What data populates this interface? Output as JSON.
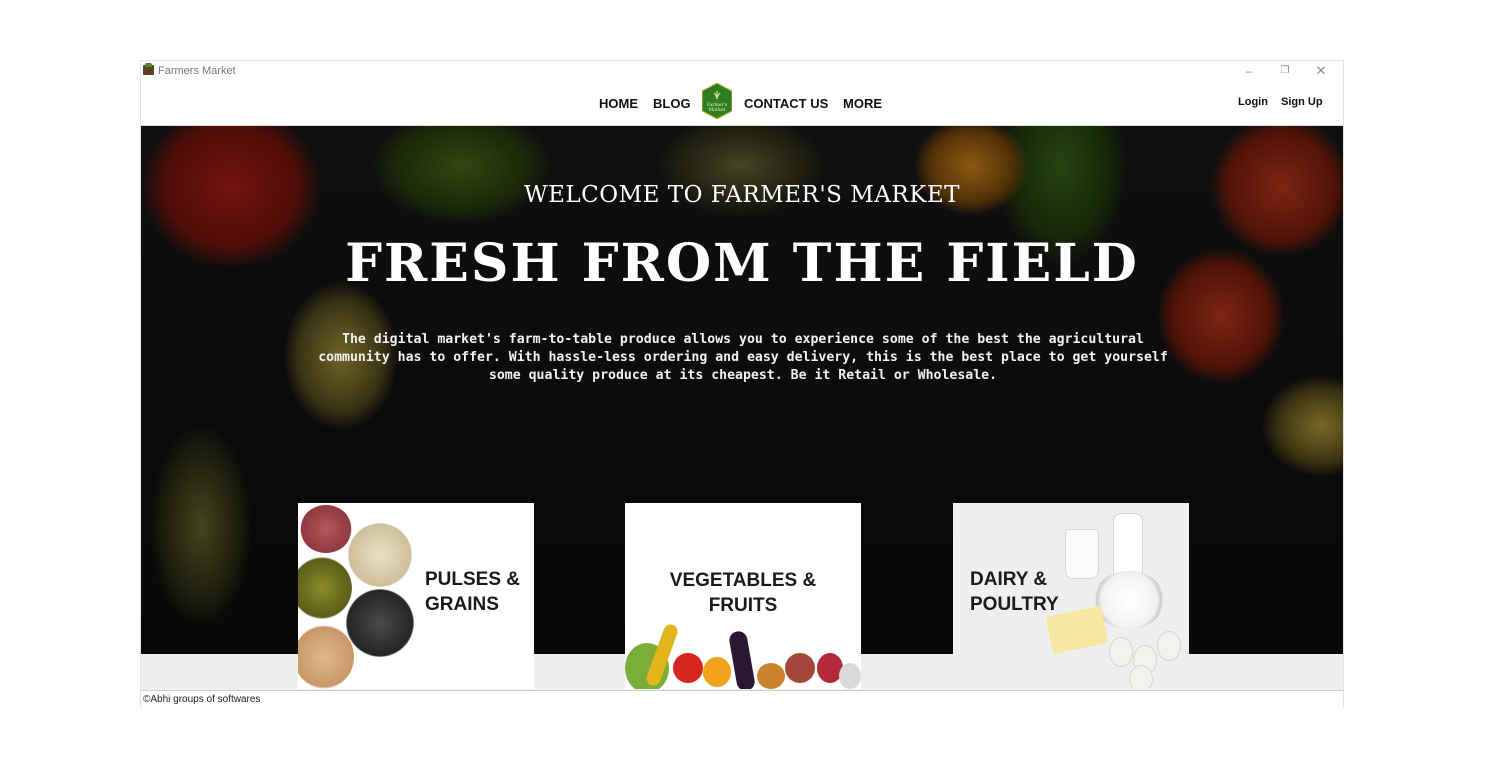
{
  "window": {
    "title": "Farmers Market",
    "controls": {
      "minimize": "–",
      "maximize": "❐",
      "close": "✕"
    }
  },
  "nav": {
    "home": "HOME",
    "blog": "BLOG",
    "contact": "CONTACT US",
    "more": "MORE",
    "login": "Login",
    "signup": "Sign Up"
  },
  "logo": {
    "text_line1": "Farmer's",
    "text_line2": "Market",
    "color": "#2f7d1f"
  },
  "hero": {
    "welcome": "WELCOME TO FARMER'S MARKET",
    "headline": "FRESH FROM THE FIELD",
    "description": "The digital market's farm-to-table produce allows you to experience some of the best the agricultural community has to offer. With hassle-less ordering and easy delivery, this is the best place to get yourself some quality produce at its cheapest. Be it Retail or Wholesale."
  },
  "categories": [
    {
      "line1": "PULSES &",
      "line2": "GRAINS"
    },
    {
      "line1": "VEGETABLES &",
      "line2": "FRUITS"
    },
    {
      "line1": "DAIRY &",
      "line2": "POULTRY"
    }
  ],
  "footer": {
    "copyright": "©Abhi groups of softwares"
  }
}
